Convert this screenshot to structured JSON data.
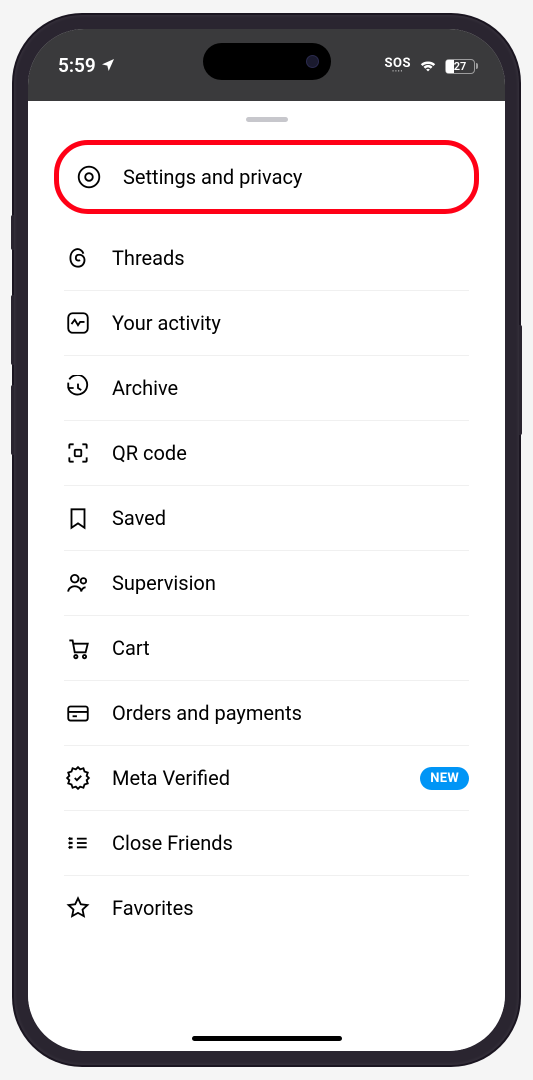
{
  "status": {
    "time": "5:59",
    "sos": "SOS",
    "battery_percent": "27"
  },
  "menu": {
    "highlighted": {
      "label": "Settings and privacy"
    },
    "items": [
      {
        "label": "Threads"
      },
      {
        "label": "Your activity"
      },
      {
        "label": "Archive"
      },
      {
        "label": "QR code"
      },
      {
        "label": "Saved"
      },
      {
        "label": "Supervision"
      },
      {
        "label": "Cart"
      },
      {
        "label": "Orders and payments"
      },
      {
        "label": "Meta Verified",
        "badge": "NEW"
      },
      {
        "label": "Close Friends"
      },
      {
        "label": "Favorites"
      }
    ]
  }
}
